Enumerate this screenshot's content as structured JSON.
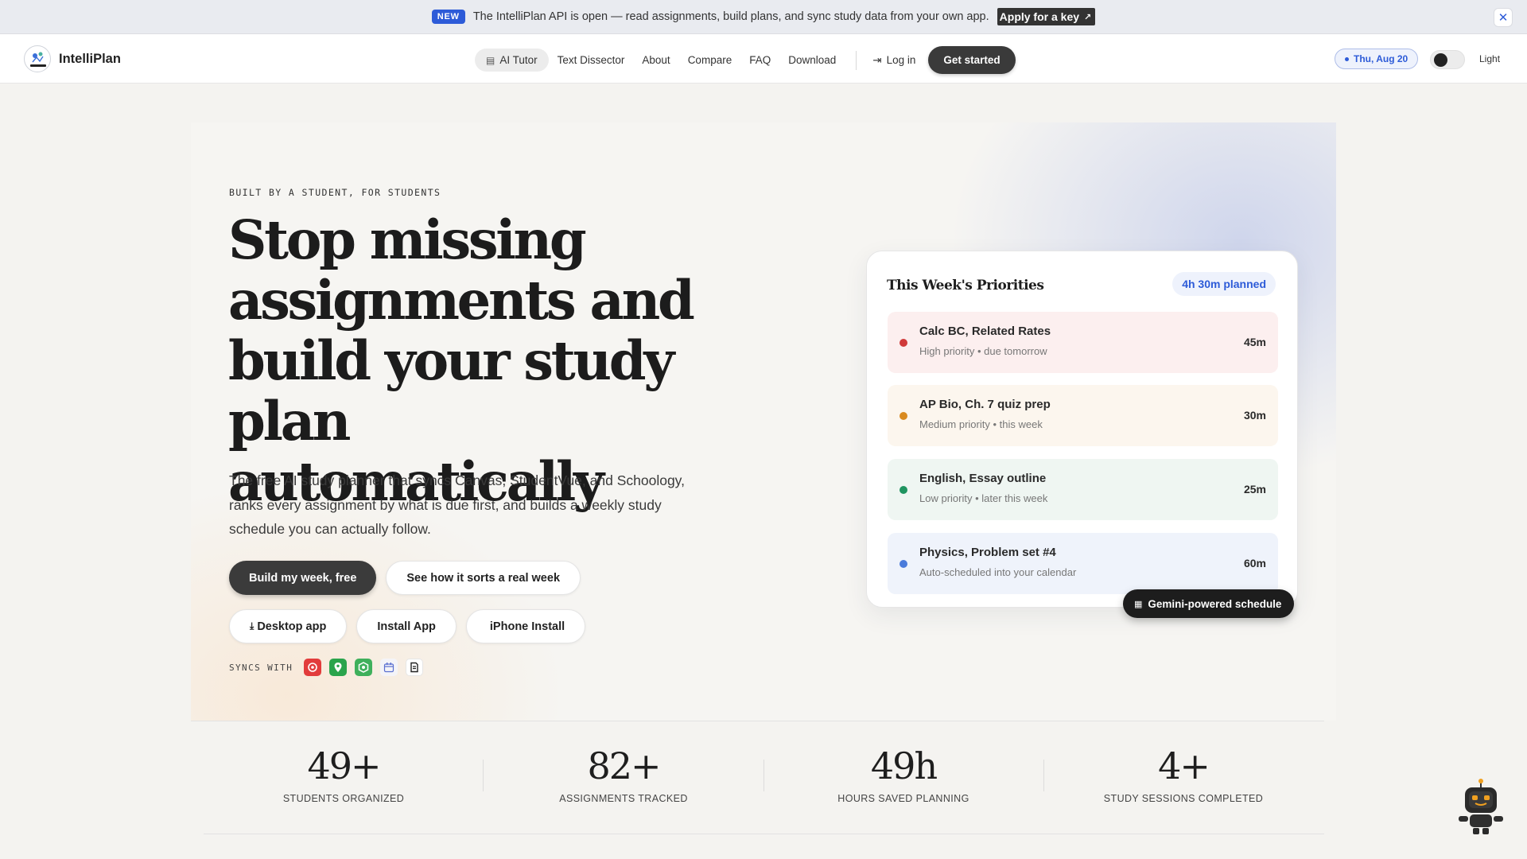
{
  "announcement": {
    "badge": "NEW",
    "text": "The IntelliPlan API is open — read assignments, build plans, and sync study data from your own app.",
    "cta": "Apply for a key",
    "close_icon": "close-icon"
  },
  "nav": {
    "brand": "IntelliPlan",
    "links": [
      "AI Tutor",
      "Text Dissector",
      "About",
      "Compare",
      "FAQ",
      "Download"
    ],
    "login": "Log in",
    "cta": "Get started",
    "date": "Thu, Aug 20",
    "theme_label": "Light"
  },
  "hero": {
    "eyebrow": "BUILT BY A STUDENT, FOR STUDENTS",
    "headline": "Stop missing assignments and build your study plan automatically",
    "subtext": "The free AI study planner that syncs Canvas, StudentVue, and Schoology, ranks every assignment by what is due first, and builds a weekly study schedule you can actually follow.",
    "primary_button": "Build my week, free",
    "secondary_button": "See how it sorts a real week",
    "desktop_button": "Desktop app",
    "install_button": "Install App",
    "iphone_button": "iPhone Install",
    "syncs_label": "SYNCS WITH"
  },
  "card": {
    "title": "This Week's Priorities",
    "planned": "4h 30m planned",
    "tasks": [
      {
        "title": "Calc BC, Related Rates",
        "meta": "High priority • due tomorrow",
        "duration": "45m",
        "color": "#d03a3a",
        "bg": "#fcefef"
      },
      {
        "title": "AP Bio, Ch. 7 quiz prep",
        "meta": "Medium priority • this week",
        "duration": "30m",
        "color": "#d98a1f",
        "bg": "#fcf6ee"
      },
      {
        "title": "English, Essay outline",
        "meta": "Low priority • later this week",
        "duration": "25m",
        "color": "#1f9460",
        "bg": "#eff6f2"
      },
      {
        "title": "Physics, Problem set #4",
        "meta": "Auto-scheduled into your calendar",
        "duration": "60m",
        "color": "#4a7bdb",
        "bg": "#eff3fb"
      }
    ],
    "badge": "Gemini-powered schedule"
  },
  "stats": [
    {
      "value": "49+",
      "label": "STUDENTS ORGANIZED"
    },
    {
      "value": "82+",
      "label": "ASSIGNMENTS TRACKED"
    },
    {
      "value": "49h",
      "label": "HOURS SAVED PLANNING"
    },
    {
      "value": "4+",
      "label": "STUDY SESSIONS COMPLETED"
    }
  ],
  "colors": {
    "accent": "#2d5bd8",
    "dark_button": "#3b3b3b"
  }
}
